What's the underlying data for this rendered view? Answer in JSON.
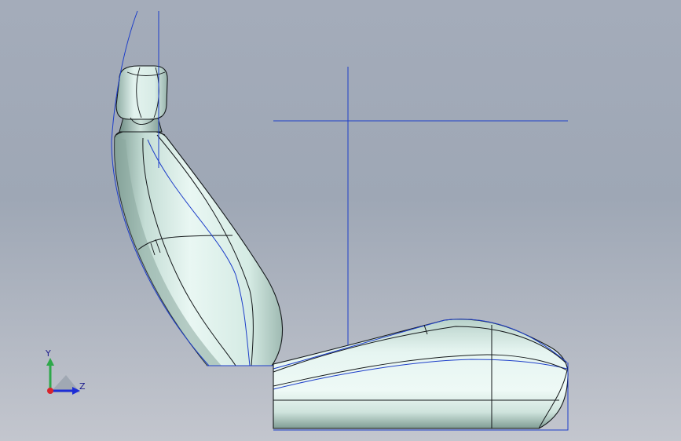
{
  "viewport": {
    "background_top": "#a4acba",
    "background_bottom": "#c3c6ce"
  },
  "model": {
    "surface_color": "#dff3ee",
    "edge_color": "#14181a",
    "sketch_color": "#1d3ec9"
  },
  "triad": {
    "y_label": "Y",
    "z_label": "Z",
    "y_color": "#2ea84a",
    "z_color": "#1e2ed6",
    "x_color": "#d8242c"
  }
}
